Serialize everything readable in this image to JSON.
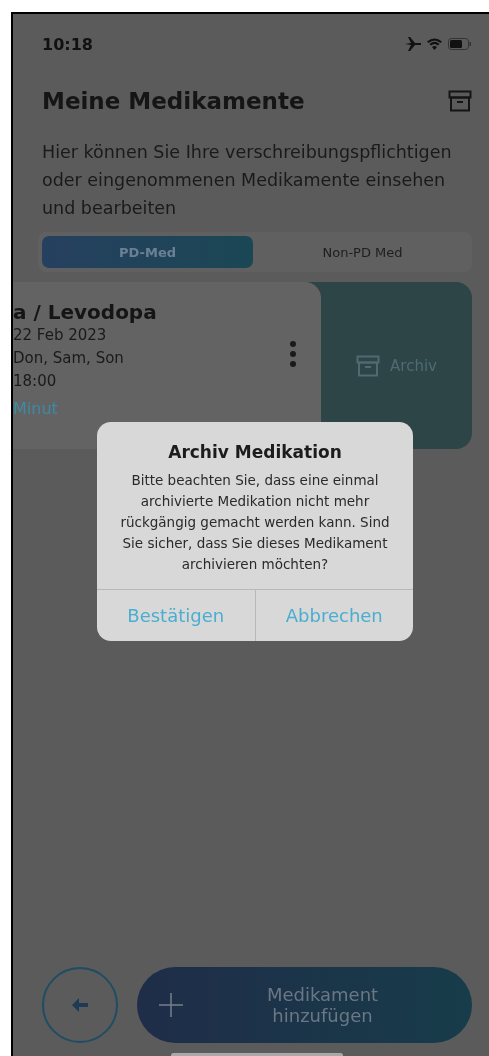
{
  "status_bar": {
    "time": "10:18"
  },
  "header": {
    "title": "Meine Medikamente",
    "description": "Hier können Sie Ihre verschreibungspflichtigen oder eingenommenen Medikamente einsehen und bearbeiten"
  },
  "tabs": [
    {
      "label": "PD-Med",
      "selected": true
    },
    {
      "label": "Non-PD Med",
      "selected": false
    }
  ],
  "medication_card": {
    "name": "a / Levodopa",
    "lines": [
      "22 Feb 2023",
      "Don, Sam, Son",
      "18:00"
    ],
    "reminder": "Minut",
    "swipe_action": "Archiv"
  },
  "dialog": {
    "title": "Archiv Medikation",
    "message": "Bitte beachten Sie, dass eine einmal archivierte Medikation nicht mehr rückgängig gemacht werden kann. Sind Sie sicher, dass Sie dieses Medikament archivieren möchten?",
    "buttons": [
      "Bestätigen",
      "Abbrechen"
    ]
  },
  "add_button": {
    "label": "Medikament hinzufügen"
  }
}
